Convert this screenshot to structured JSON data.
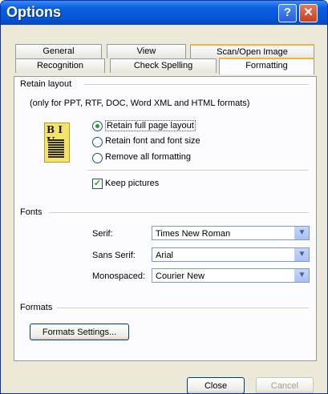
{
  "window": {
    "title": "Options",
    "help_glyph": "?",
    "close_glyph": "✕"
  },
  "tabs_row1": [
    "General",
    "View",
    "Scan/Open Image"
  ],
  "tabs_row2": [
    "Recognition",
    "Check Spelling",
    "Formatting"
  ],
  "retain_layout": {
    "heading": "Retain layout",
    "note": "(only for PPT, RTF, DOC, Word XML and HTML formats)",
    "icon_text": "B I U",
    "options": [
      "Retain full page layout",
      "Retain font and font size",
      "Remove all formatting"
    ],
    "selected_index": 0,
    "keep_pictures_label": "Keep pictures",
    "keep_pictures_checked": true
  },
  "fonts": {
    "heading": "Fonts",
    "serif_label": "Serif:",
    "serif_value": "Times New Roman",
    "sans_label": "Sans Serif:",
    "sans_value": "Arial",
    "mono_label": "Monospaced:",
    "mono_value": "Courier New"
  },
  "formats": {
    "heading": "Formats",
    "settings_button": "Formats Settings..."
  },
  "footer": {
    "close": "Close",
    "cancel": "Cancel"
  },
  "colors": {
    "titlebar": "#0656d6",
    "accent_tab": "#f4b33b",
    "radio_dot": "#21a121"
  }
}
